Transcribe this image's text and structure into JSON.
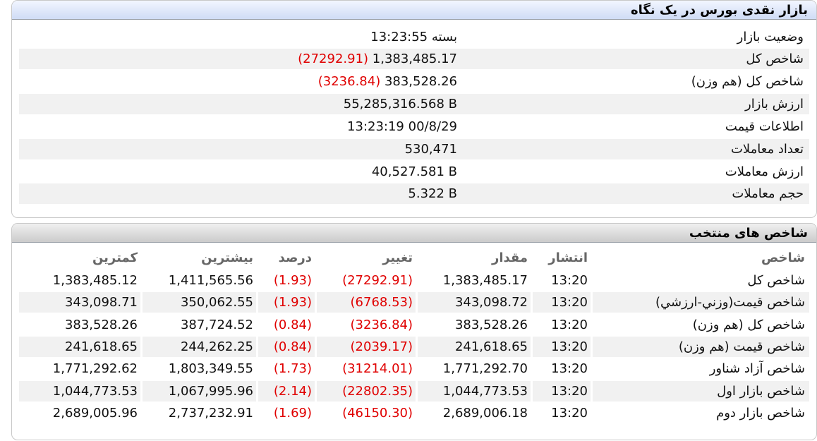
{
  "market_panel": {
    "title": "بازار نقدی بورس در یک نگاه",
    "rows": [
      {
        "label": "وضعیت بازار",
        "value": "بسته 13:23:55",
        "change": ""
      },
      {
        "label": "شاخص کل",
        "value": "1,383,485.17",
        "change": "(27292.91) "
      },
      {
        "label": "شاخص کل (هم وزن)",
        "value": "383,528.26",
        "change": "(3236.84) "
      },
      {
        "label": "ارزش بازار",
        "value": "55,285,316.568 B",
        "change": ""
      },
      {
        "label": "اطلاعات قیمت",
        "value": "13:23:19 00/8/29",
        "change": ""
      },
      {
        "label": "تعداد معاملات",
        "value": "530,471",
        "change": ""
      },
      {
        "label": "ارزش معاملات",
        "value": "40,527.581 B",
        "change": ""
      },
      {
        "label": "حجم معاملات",
        "value": "5.322 B",
        "change": ""
      }
    ]
  },
  "index_panel": {
    "title": "شاخص های منتخب",
    "headers": {
      "name": "شاخص",
      "time": "انتشار",
      "value": "مقدار",
      "change": "تغییر",
      "percent": "درصد",
      "max": "بیشترین",
      "min": "کمترین"
    },
    "rows": [
      {
        "name": "شاخص کل",
        "time": "13:20",
        "value": "1,383,485.17",
        "change": "(27292.91)",
        "percent": "(1.93)",
        "max": "1,411,565.56",
        "min": "1,383,485.12"
      },
      {
        "name": "شاخص قیمت(وزني-ارزشي)",
        "time": "13:20",
        "value": "343,098.72",
        "change": "(6768.53)",
        "percent": "(1.93)",
        "max": "350,062.55",
        "min": "343,098.71"
      },
      {
        "name": "شاخص کل (هم وزن)",
        "time": "13:20",
        "value": "383,528.26",
        "change": "(3236.84)",
        "percent": "(0.84)",
        "max": "387,724.52",
        "min": "383,528.26"
      },
      {
        "name": "شاخص قیمت (هم وزن)",
        "time": "13:20",
        "value": "241,618.65",
        "change": "(2039.17)",
        "percent": "(0.84)",
        "max": "244,262.25",
        "min": "241,618.65"
      },
      {
        "name": "شاخص آزاد شناور",
        "time": "13:20",
        "value": "1,771,292.70",
        "change": "(31214.01)",
        "percent": "(1.73)",
        "max": "1,803,349.55",
        "min": "1,771,292.62"
      },
      {
        "name": "شاخص بازار اول",
        "time": "13:20",
        "value": "1,044,773.53",
        "change": "(22802.35)",
        "percent": "(2.14)",
        "max": "1,067,995.96",
        "min": "1,044,773.53"
      },
      {
        "name": "شاخص بازار دوم",
        "time": "13:20",
        "value": "2,689,006.18",
        "change": "(46150.30)",
        "percent": "(1.69)",
        "max": "2,737,232.91",
        "min": "2,689,005.96"
      }
    ]
  },
  "colors": {
    "negative": "#e00000",
    "row_alt": "#f1f1f1",
    "header_blue": "#cfdcf5",
    "header_gray": "#cbcbcb"
  }
}
